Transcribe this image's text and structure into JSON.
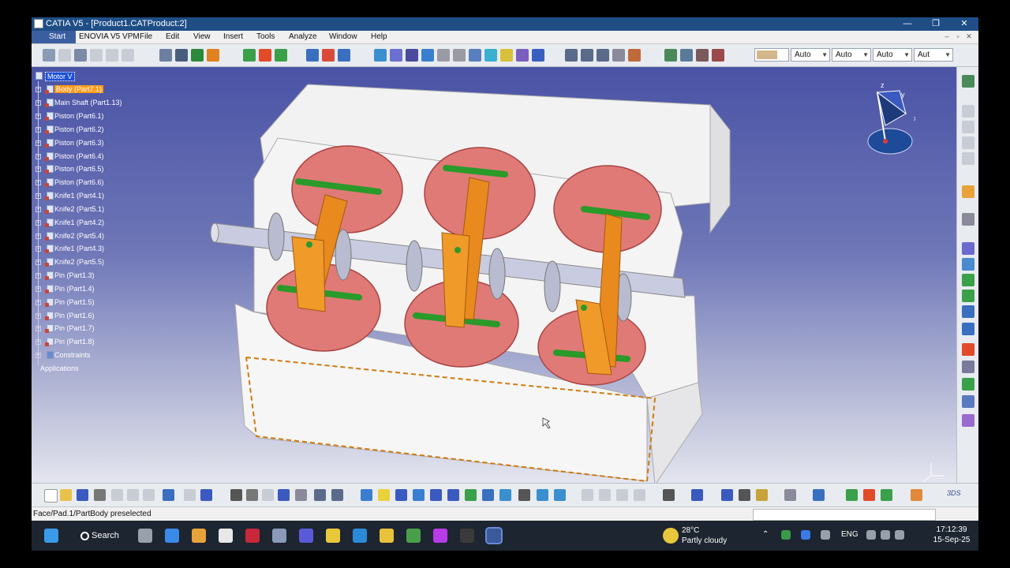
{
  "window": {
    "title": "CATIA V5 - [Product1.CATProduct:2]",
    "controls": [
      "—",
      "❐",
      "✕"
    ]
  },
  "menu": {
    "start": "Start",
    "items": [
      "ENOVIA V5 VPM",
      "File",
      "Edit",
      "View",
      "Insert",
      "Tools",
      "Analyze",
      "Window",
      "Help"
    ],
    "doc_controls": [
      "–",
      "▫",
      "✕"
    ]
  },
  "toolbar": {
    "graphic_props": [
      "Auto",
      "Auto",
      "Auto",
      "Aut"
    ],
    "color_swatch": "#d2b78a"
  },
  "tree": {
    "root": "Motor V",
    "items": [
      {
        "label": "Body (Part7.1)",
        "highlighted": true
      },
      {
        "label": "Main Shaft (Part1.13)"
      },
      {
        "label": "Piston (Part6.1)"
      },
      {
        "label": "Piston (Part6.2)"
      },
      {
        "label": "Piston (Part6.3)"
      },
      {
        "label": "Piston (Part6.4)"
      },
      {
        "label": "Piston (Part6.5)"
      },
      {
        "label": "Piston (Part6.6)"
      },
      {
        "label": "Knife1 (Part4.1)"
      },
      {
        "label": "Knife2 (Part5.1)"
      },
      {
        "label": "Knife1 (Part4.2)"
      },
      {
        "label": "Knife2 (Part5.4)"
      },
      {
        "label": "Knife1 (Part4.3)"
      },
      {
        "label": "Knife2 (Part5.5)"
      },
      {
        "label": "Pin (Part1.3)"
      },
      {
        "label": "Pin (Part1.4)"
      },
      {
        "label": "Pin (Part1.5)"
      },
      {
        "label": "Pin (Part1.6)"
      },
      {
        "label": "Pin (Part1.7)"
      },
      {
        "label": "Pin (Part1.8)"
      },
      {
        "label": "Constraints"
      },
      {
        "label": "Applications"
      }
    ]
  },
  "compass": {
    "z": "z",
    "y": "y",
    "x": "x"
  },
  "status": {
    "text": "Face/Pad.1/PartBody preselected"
  },
  "taskbar": {
    "search": "Search",
    "weather_temp": "28°C",
    "weather_desc": "Partly cloudy",
    "lang": "ENG",
    "time": "17:12:39",
    "date": "15-Sep-25"
  }
}
